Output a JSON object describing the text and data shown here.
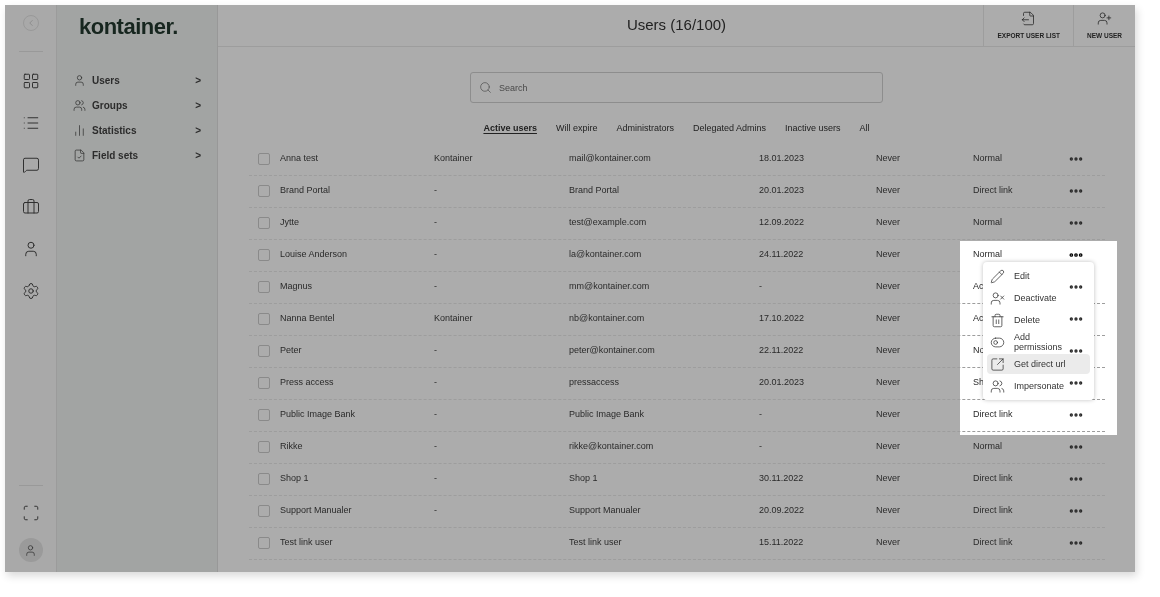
{
  "sidebar": {
    "logo": "kontainer.",
    "nav": [
      {
        "kind": "user",
        "label": "Users",
        "chevron": ">"
      },
      {
        "kind": "groups",
        "label": "Groups",
        "chevron": ">"
      },
      {
        "kind": "stats",
        "label": "Statistics",
        "chevron": ">"
      },
      {
        "kind": "fields",
        "label": "Field sets",
        "chevron": ">"
      }
    ]
  },
  "header": {
    "title": "Users (16/100)",
    "actions": [
      {
        "kind": "export",
        "label": "EXPORT USER LIST"
      },
      {
        "kind": "new",
        "label": "NEW USER"
      }
    ]
  },
  "search": {
    "placeholder": "Search"
  },
  "filters": [
    {
      "label": "Active users",
      "selected": true
    },
    {
      "label": "Will expire",
      "selected": false
    },
    {
      "label": "Administrators",
      "selected": false
    },
    {
      "label": "Delegated Admins",
      "selected": false
    },
    {
      "label": "Inactive users",
      "selected": false
    },
    {
      "label": "All",
      "selected": false
    }
  ],
  "rows": [
    {
      "cells": [
        "Anna test",
        "Kontainer",
        "mail@kontainer.com",
        "18.01.2023",
        "Never",
        "Normal"
      ],
      "checked": false,
      "menu_open": false
    },
    {
      "cells": [
        "Brand Portal",
        "-",
        "Brand Portal",
        "20.01.2023",
        "Never",
        "Direct link"
      ],
      "checked": false,
      "menu_open": false
    },
    {
      "cells": [
        "Jytte",
        "-",
        "test@example.com",
        "12.09.2022",
        "Never",
        "Normal"
      ],
      "checked": false,
      "menu_open": false
    },
    {
      "cells": [
        "Louise Anderson",
        "-",
        "la@kontainer.com",
        "24.11.2022",
        "Never",
        "Normal"
      ],
      "checked": false,
      "menu_open": true
    },
    {
      "cells": [
        "Magnus",
        "-",
        "mm@kontainer.com",
        "-",
        "Never",
        "Ac"
      ],
      "checked": false,
      "menu_open": false
    },
    {
      "cells": [
        "Nanna Bentel",
        "Kontainer",
        "nb@kontainer.com",
        "17.10.2022",
        "Never",
        "Ac"
      ],
      "checked": false,
      "menu_open": false
    },
    {
      "cells": [
        "Peter",
        "-",
        "peter@kontainer.com",
        "22.11.2022",
        "Never",
        "No"
      ],
      "checked": false,
      "menu_open": false
    },
    {
      "cells": [
        "Press access",
        "-",
        "pressaccess",
        "20.01.2023",
        "Never",
        "Sh"
      ],
      "checked": false,
      "menu_open": false
    },
    {
      "cells": [
        "Public Image Bank",
        "-",
        "Public Image Bank",
        "-",
        "Never",
        "Direct link"
      ],
      "checked": false,
      "menu_open": false
    },
    {
      "cells": [
        "Rikke",
        "-",
        "rikke@kontainer.com",
        "-",
        "Never",
        "Normal"
      ],
      "checked": false,
      "menu_open": false
    },
    {
      "cells": [
        "Shop 1",
        "-",
        "Shop 1",
        "30.11.2022",
        "Never",
        "Direct link"
      ],
      "checked": false,
      "menu_open": false
    },
    {
      "cells": [
        "Support Manualer",
        "-",
        "Support Manualer",
        "20.09.2022",
        "Never",
        "Direct link"
      ],
      "checked": false,
      "menu_open": false
    },
    {
      "cells": [
        "Test link user",
        "",
        "Test link user",
        "15.11.2022",
        "Never",
        "Direct link"
      ],
      "checked": false,
      "menu_open": false
    }
  ],
  "row_menu": [
    {
      "kind": "edit",
      "label": "Edit",
      "selected": false
    },
    {
      "kind": "deactivate",
      "label": "Deactivate",
      "selected": false
    },
    {
      "kind": "delete",
      "label": "Delete",
      "selected": false
    },
    {
      "kind": "permissions",
      "label": "Add permissions",
      "selected": false
    },
    {
      "kind": "url",
      "label": "Get direct url",
      "selected": true
    },
    {
      "kind": "impersonate",
      "label": "Impersonate",
      "selected": false
    }
  ]
}
